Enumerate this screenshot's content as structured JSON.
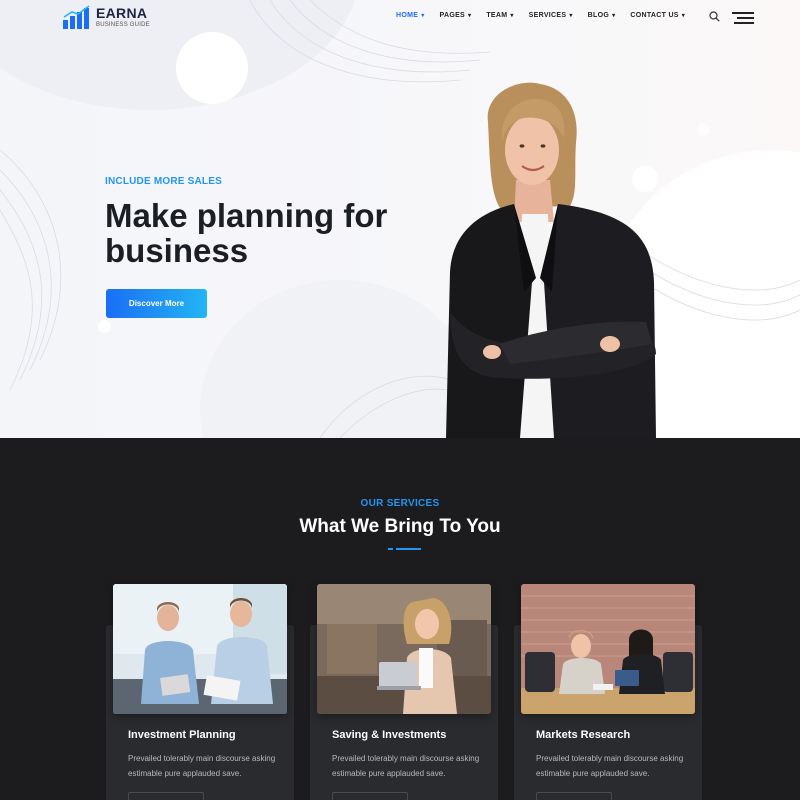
{
  "header": {
    "logo_name": "EARNA",
    "logo_sub": "BUSINESS GUIDE",
    "nav": [
      {
        "label": "HOME",
        "active": true
      },
      {
        "label": "PAGES"
      },
      {
        "label": "TEAM"
      },
      {
        "label": "SERVICES"
      },
      {
        "label": "BLOG"
      },
      {
        "label": "CONTACT US"
      }
    ],
    "icons": [
      "search-icon",
      "menu-icon",
      "chevron-down-icon"
    ]
  },
  "hero": {
    "kicker": "INCLUDE MORE SALES",
    "title": "Make planning for business",
    "button_label": "Discover More"
  },
  "services": {
    "kicker": "OUR SERVICES",
    "title": "What We Bring To You",
    "cards": [
      {
        "title": "Investment Planning",
        "text": "Prevailed tolerably main discourse asking estimable pure applauded save."
      },
      {
        "title": "Saving & Investments",
        "text": "Prevailed tolerably main discourse asking estimable pure applauded save."
      },
      {
        "title": "Markets Research",
        "text": "Prevailed tolerably main discourse asking estimable pure applauded save."
      }
    ]
  },
  "colors": {
    "accent": "#1a6ef5",
    "accent_light": "#23b5f3",
    "dark_bg": "#1c1c1f",
    "card_bg": "#2a2b2f"
  }
}
